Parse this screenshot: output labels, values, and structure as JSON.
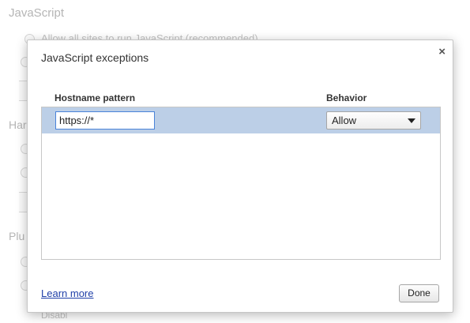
{
  "background": {
    "section_javascript": "JavaScript",
    "javascript_option_allow": "Allow all sites to run JavaScript (recommended)",
    "section_handlers_partial": "Har",
    "section_plugins_partial": "Plu",
    "bottom_partial_text": "Disabl"
  },
  "dialog": {
    "title": "JavaScript exceptions",
    "close_symbol": "×",
    "columns": {
      "hostname": "Hostname pattern",
      "behavior": "Behavior"
    },
    "rows": [
      {
        "pattern": "https://*",
        "behavior": "Allow"
      }
    ],
    "learn_more": "Learn more",
    "done": "Done"
  }
}
